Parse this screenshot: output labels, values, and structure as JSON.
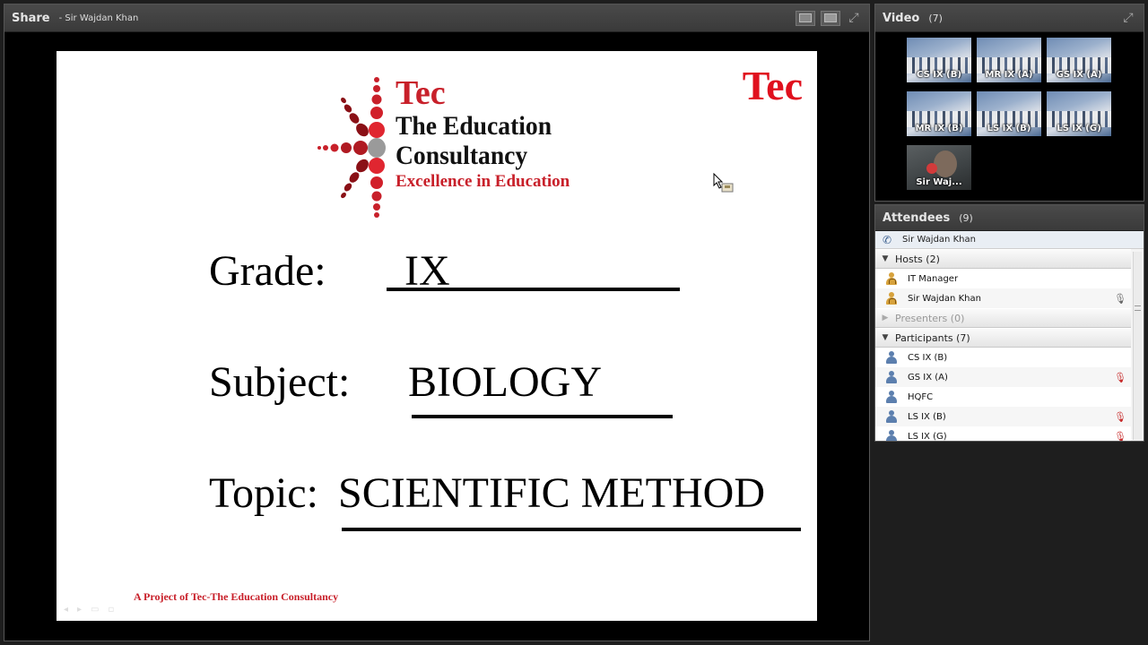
{
  "share": {
    "title": "Share",
    "presenter": "- Sir Wajdan Khan"
  },
  "slide": {
    "logo": {
      "brand": "Tec",
      "line1": "The Education",
      "line2": "Consultancy",
      "tagline": "Excellence in Education"
    },
    "corner_brand": "Tec",
    "grade_label": "Grade:",
    "grade_value": "IX",
    "subject_label": "Subject:",
    "subject_value": "BIOLOGY",
    "topic_label": "Topic:",
    "topic_value": "SCIENTIFIC METHOD",
    "footer": "A Project of Tec-The Education Consultancy"
  },
  "video": {
    "title": "Video",
    "count": "(7)",
    "feeds": [
      {
        "label": "CS IX (B)"
      },
      {
        "label": "MR IX (A)"
      },
      {
        "label": "GS IX (A)"
      },
      {
        "label": "MR IX (B)"
      },
      {
        "label": "LS IX (B)"
      },
      {
        "label": "LS IX (G)"
      },
      {
        "label": "Sir Waj..."
      }
    ]
  },
  "attendees": {
    "title": "Attendees",
    "count": "(9)",
    "self": "Sir Wajdan Khan",
    "groups": {
      "hosts": "Hosts (2)",
      "presenters": "Presenters (0)",
      "participants": "Participants (7)"
    },
    "hosts": [
      {
        "name": "IT  Manager",
        "mic": ""
      },
      {
        "name": "Sir Wajdan Khan",
        "mic": "on"
      }
    ],
    "participants": [
      {
        "name": "CS IX (B)",
        "mic": ""
      },
      {
        "name": "GS IX (A)",
        "mic": "muted"
      },
      {
        "name": "HQFC",
        "mic": ""
      },
      {
        "name": "LS IX (B)",
        "mic": "muted"
      },
      {
        "name": "LS IX (G)",
        "mic": "muted"
      }
    ]
  },
  "colors": {
    "brand_red": "#c8202a",
    "pod_header": "#3a3a3a"
  }
}
